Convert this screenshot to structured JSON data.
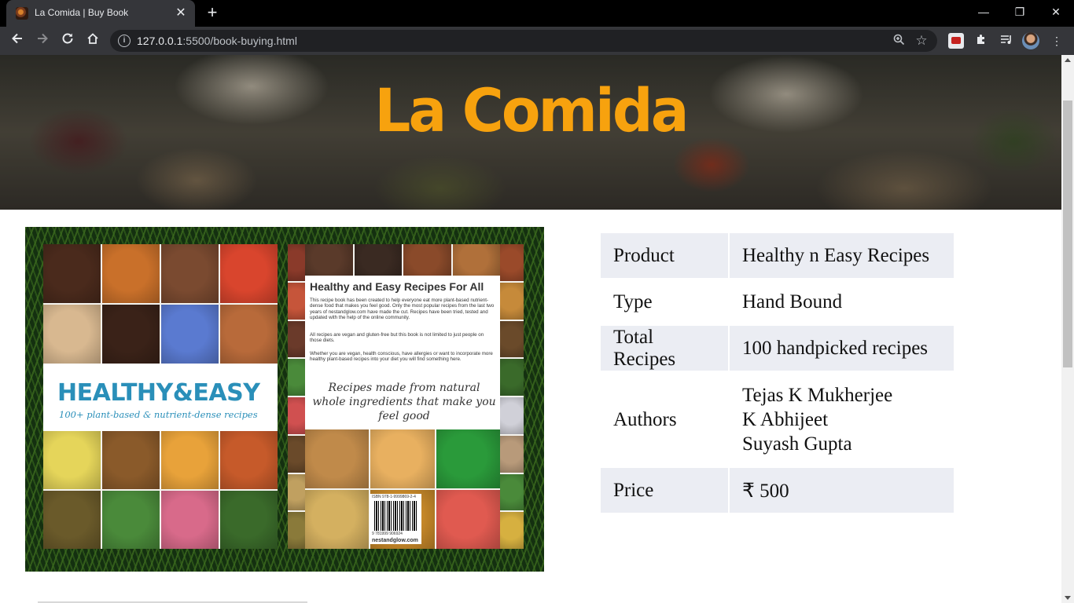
{
  "browser": {
    "tab_title": "La Comida | Buy Book",
    "tab_close": "✕",
    "new_tab": "+",
    "url_host": "127.0.0.1",
    "url_path": ":5500/book-buying.html",
    "window": {
      "minimize": "—",
      "maximize": "❐",
      "close": "✕"
    }
  },
  "hero": {
    "title": "La Comida"
  },
  "book": {
    "front": {
      "title": "HEALTHY&EASY",
      "subtitle": "100+ plant-based & nutrient-dense recipes"
    },
    "back": {
      "heading": "Healthy and Easy Recipes For All",
      "paragraphs": [
        "This recipe book has been created to help everyone eat more plant-based nutrient-dense food that makes you feel good. Only the most popular recipes from the last two years of nestandglow.com have made the cut. Recipes have been tried, tested and updated with the help of the online community.",
        "All recipes are vegan and gluten-free but this book is not limited to just people on those diets.",
        "Whether you are vegan, health conscious, have allergies or want to incorporate more healthy plant-based recipes into your diet you will find something here."
      ],
      "script": "Recipes made from natural whole ingredients that make you feel good",
      "isbn": "ISBN 978-1-9999869-2-4",
      "barcode_number": "9 781999 906924",
      "website": "nestandglow.com"
    },
    "tile_colors": {
      "front_top": [
        "#4a2a1c",
        "#c9702a",
        "#7a4a30",
        "#d9452d",
        "#d8b890",
        "#3a2218",
        "#5a7ad0",
        "#b86a3a"
      ],
      "front_bottom": [
        "#e5d55a",
        "#8a5a2a",
        "#e8a23a",
        "#c65a2a",
        "#6a5a2a",
        "#4a8a3a",
        "#d86a8a",
        "#3a6a2a"
      ],
      "back_top": [
        "#5a3a2a",
        "#3a2a22",
        "#8a4a2a",
        "#b0703a"
      ],
      "back_left": [
        "#8a3a2a",
        "#c6553a",
        "#6a3a2a",
        "#4a8a3a",
        "#d05050",
        "#6a4a2a",
        "#c0a060",
        "#8a7a3a"
      ],
      "back_right": [
        "#9a4a2a",
        "#c68a3a",
        "#6a4a2a",
        "#3a6a2a",
        "#d0d0d8",
        "#b89a7a",
        "#4a8a3a",
        "#d6b040"
      ],
      "back_bottom": [
        "#c08a4a",
        "#e8b060",
        "#2a9a3a",
        "#d4b060",
        "#c98a2a",
        "#e05a50"
      ]
    }
  },
  "info": {
    "rows": [
      {
        "label": "Product",
        "value": "Healthy n Easy Recipes"
      },
      {
        "label": "Type",
        "value": "Hand Bound"
      },
      {
        "label": "Total Recipes",
        "value": "100 handpicked recipes"
      },
      {
        "label": "Authors",
        "values": [
          "Tejas K Mukherjee",
          "K Abhijeet",
          "Suyash Gupta"
        ]
      },
      {
        "label": "Price",
        "value": "₹ 500"
      }
    ]
  }
}
